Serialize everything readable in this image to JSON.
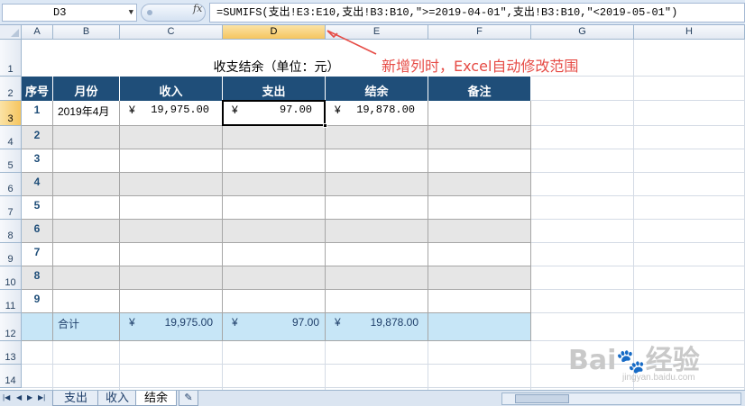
{
  "formula_bar": {
    "name_box": "D3",
    "formula": "=SUMIFS(支出!E3:E10,支出!B3:B10,\">=2019-04-01\",支出!B3:B10,\"<2019-05-01\")"
  },
  "columns": [
    "A",
    "B",
    "C",
    "D",
    "E",
    "F",
    "G",
    "H"
  ],
  "active_column": "D",
  "rows": [
    "1",
    "2",
    "3",
    "4",
    "5",
    "6",
    "7",
    "8",
    "9",
    "10",
    "11",
    "12",
    "13",
    "14"
  ],
  "active_row": "3",
  "sheet": {
    "title": "收支结余（单位：元）",
    "headers": [
      "序号",
      "月份",
      "收入",
      "支出",
      "结余",
      "备注"
    ],
    "data_rows": [
      {
        "seq": "1",
        "month": "2019年4月",
        "income_sym": "¥",
        "income": "19,975.00",
        "expense_sym": "¥",
        "expense": "97.00",
        "balance_sym": "¥",
        "balance": "19,878.00",
        "note": ""
      },
      {
        "seq": "2"
      },
      {
        "seq": "3"
      },
      {
        "seq": "4"
      },
      {
        "seq": "5"
      },
      {
        "seq": "6"
      },
      {
        "seq": "7"
      },
      {
        "seq": "8"
      },
      {
        "seq": "9"
      }
    ],
    "total": {
      "label": "合计",
      "income_sym": "¥",
      "income": "19,975.00",
      "expense_sym": "¥",
      "expense": "97.00",
      "balance_sym": "¥",
      "balance": "19,878.00"
    }
  },
  "annotation": "新增列时，Excel自动修改范围",
  "tabs": [
    "支出",
    "收入",
    "结余"
  ],
  "active_tab": "结余",
  "watermark": {
    "text": "Baidu经验",
    "sub": "jingyan.baidu.com"
  },
  "colors": {
    "header_bg": "#1f4e79",
    "total_bg": "#c7e6f7",
    "band_gray": "#e6e6e6",
    "annotation": "#e64b45",
    "active_header": "#f5c55f"
  }
}
